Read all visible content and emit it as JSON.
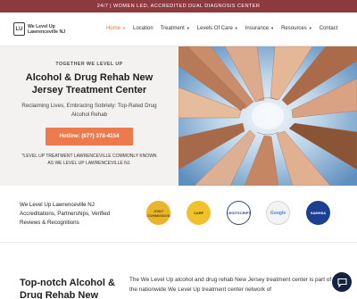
{
  "topbar": {
    "text": "24/7 | WOMEN LED, ACCREDITED DUAL DIAGNOSIS CENTER"
  },
  "logo": {
    "mark": "LU",
    "line1": "We Level Up",
    "line2": "Lawrenceville NJ"
  },
  "menu": [
    {
      "label": "Home",
      "caret": true,
      "active": true
    },
    {
      "label": "Location",
      "caret": false
    },
    {
      "label": "Treatment",
      "caret": true
    },
    {
      "label": "Levels Of Care",
      "caret": true
    },
    {
      "label": "Insurance",
      "caret": true
    },
    {
      "label": "Resources",
      "caret": true
    },
    {
      "label": "Contact",
      "caret": false
    }
  ],
  "hero": {
    "eyebrow": "TOGETHER WE LEVEL UP",
    "title": "Alcohol & Drug Rehab New Jersey Treatment Center",
    "subtitle": "Reclaiming Lives, Embracing Sobriety: Top-Rated Drug Alcohol Rehab",
    "hotline": "Hotline: (877) 378-4154",
    "note": "*LEVEL UP TREATMENT LAWRENCEVILLE COMMONLY KNOWN AS WE LEVEL UP LAWRENCEVILLE NJ."
  },
  "accreditations": {
    "text": "We Level Up Lawrenceville NJ Accreditations, Partnerships, Verified Reviews & Recognitions",
    "badges": [
      "JOINT COMMISSION",
      "CARF",
      "LEGITSCRIPT",
      "Google",
      "SAMHSA"
    ]
  },
  "intro": {
    "title": "Top-notch Alcohol & Drug Rehab New",
    "text": "The We Level Up alcohol and drug rehab New Jersey treatment center is part of the nationwide We Level Up treatment center network of"
  },
  "colors": {
    "topbar": "#8d3a3e",
    "accent": "#ec7a4c",
    "active_menu": "#e8763c",
    "chat": "#14233f"
  }
}
